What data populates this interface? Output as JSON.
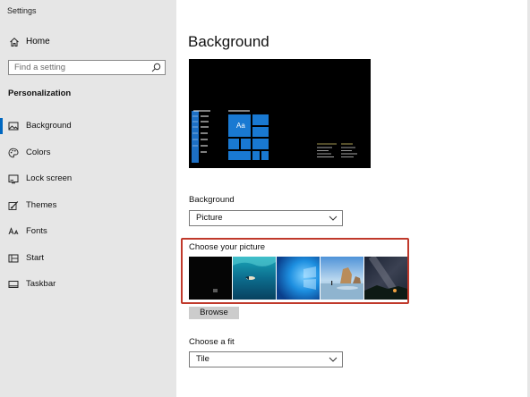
{
  "window": {
    "title": "Settings"
  },
  "sidebar": {
    "home_label": "Home",
    "search_placeholder": "Find a setting",
    "section_title": "Personalization",
    "items": [
      {
        "label": "Background",
        "icon": "picture-icon",
        "active": true
      },
      {
        "label": "Colors",
        "icon": "palette-icon",
        "active": false
      },
      {
        "label": "Lock screen",
        "icon": "lock-screen-icon",
        "active": false
      },
      {
        "label": "Themes",
        "icon": "brush-icon",
        "active": false
      },
      {
        "label": "Fonts",
        "icon": "fonts-icon",
        "active": false
      },
      {
        "label": "Start",
        "icon": "start-icon",
        "active": false
      },
      {
        "label": "Taskbar",
        "icon": "taskbar-icon",
        "active": false
      }
    ]
  },
  "main": {
    "title": "Background",
    "preview": {
      "tile_text": "Aa"
    },
    "background_label": "Background",
    "background_value": "Picture",
    "choose_picture_label": "Choose your picture",
    "pictures": [
      {
        "name": "dark-picture"
      },
      {
        "name": "underwater-picture"
      },
      {
        "name": "windows-blue-picture"
      },
      {
        "name": "beach-rocks-picture"
      },
      {
        "name": "night-sky-picture"
      }
    ],
    "browse_label": "Browse",
    "fit_label": "Choose a fit",
    "fit_value": "Tile"
  },
  "colors": {
    "accent": "#0067c0",
    "tile_blue": "#1979d2",
    "highlight_frame": "#c0392b",
    "sidebar_bg": "#e6e6e6"
  }
}
